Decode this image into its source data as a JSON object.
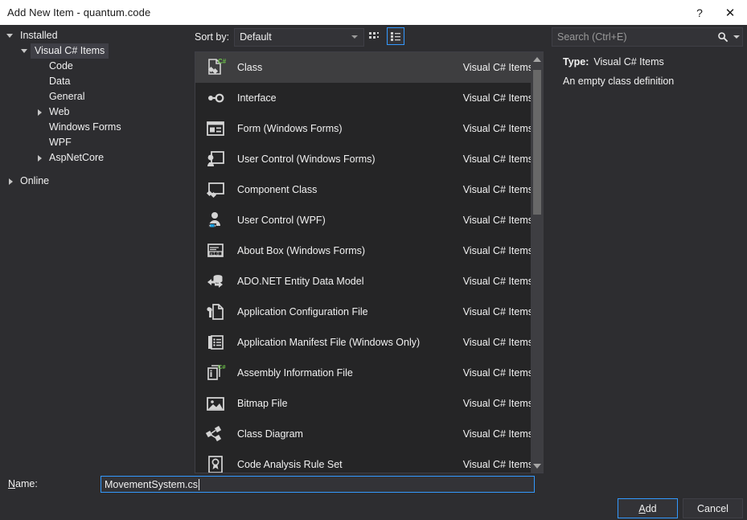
{
  "window": {
    "title": "Add New Item - quantum.code",
    "help_label": "?",
    "close_label": "✕"
  },
  "sidebar": {
    "groups": [
      {
        "label": "Installed",
        "expander": "down",
        "level": 0,
        "selected": false
      },
      {
        "label": "Visual C# Items",
        "expander": "down",
        "level": 1,
        "selected": true
      },
      {
        "label": "Code",
        "expander": "none",
        "level": 2,
        "selected": false
      },
      {
        "label": "Data",
        "expander": "none",
        "level": 2,
        "selected": false
      },
      {
        "label": "General",
        "expander": "none",
        "level": 2,
        "selected": false
      },
      {
        "label": "Web",
        "expander": "right",
        "level": 2,
        "selected": false
      },
      {
        "label": "Windows Forms",
        "expander": "none",
        "level": 2,
        "selected": false
      },
      {
        "label": "WPF",
        "expander": "none",
        "level": 2,
        "selected": false
      },
      {
        "label": "AspNetCore",
        "expander": "right",
        "level": 2,
        "selected": false
      },
      {
        "label": "Online",
        "expander": "right",
        "level": 0,
        "selected": false
      }
    ]
  },
  "toolbar": {
    "sort_label": "Sort by:",
    "sort_value": "Default",
    "grid_view_name": "grid-view-icon",
    "list_view_name": "list-view-icon",
    "active_view": "list"
  },
  "search": {
    "placeholder": "Search (Ctrl+E)",
    "value": "",
    "icon": "search-icon",
    "dropdown_icon": "chevron-down-icon"
  },
  "list": {
    "items": [
      {
        "name": "Class",
        "category": "Visual C# Items",
        "icon": "class-file-icon",
        "selected": true
      },
      {
        "name": "Interface",
        "category": "Visual C# Items",
        "icon": "interface-icon",
        "selected": false
      },
      {
        "name": "Form (Windows Forms)",
        "category": "Visual C# Items",
        "icon": "form-icon",
        "selected": false
      },
      {
        "name": "User Control (Windows Forms)",
        "category": "Visual C# Items",
        "icon": "user-control-winforms-icon",
        "selected": false
      },
      {
        "name": "Component Class",
        "category": "Visual C# Items",
        "icon": "component-class-icon",
        "selected": false
      },
      {
        "name": "User Control (WPF)",
        "category": "Visual C# Items",
        "icon": "user-control-wpf-icon",
        "selected": false
      },
      {
        "name": "About Box (Windows Forms)",
        "category": "Visual C# Items",
        "icon": "about-box-icon",
        "selected": false
      },
      {
        "name": "ADO.NET Entity Data Model",
        "category": "Visual C# Items",
        "icon": "ado-net-entity-icon",
        "selected": false
      },
      {
        "name": "Application Configuration File",
        "category": "Visual C# Items",
        "icon": "app-config-icon",
        "selected": false
      },
      {
        "name": "Application Manifest File (Windows Only)",
        "category": "Visual C# Items",
        "icon": "app-manifest-icon",
        "selected": false
      },
      {
        "name": "Assembly Information File",
        "category": "Visual C# Items",
        "icon": "assembly-info-icon",
        "selected": false
      },
      {
        "name": "Bitmap File",
        "category": "Visual C# Items",
        "icon": "bitmap-icon",
        "selected": false
      },
      {
        "name": "Class Diagram",
        "category": "Visual C# Items",
        "icon": "class-diagram-icon",
        "selected": false
      },
      {
        "name": "Code Analysis Rule Set",
        "category": "Visual C# Items",
        "icon": "rule-set-icon",
        "selected": false
      }
    ]
  },
  "details": {
    "type_key": "Type:",
    "type_value": "Visual C# Items",
    "description": "An empty class definition"
  },
  "name_field": {
    "label_prefix": "",
    "label_accel": "N",
    "label_suffix": "ame:",
    "value": "MovementSystem.cs"
  },
  "buttons": {
    "add_accel": "A",
    "add_rest": "dd",
    "cancel": "Cancel"
  },
  "colors": {
    "accent": "#3399ff",
    "dialog_bg": "#2d2d30",
    "list_bg": "#252526",
    "selected_row": "#3e3e40",
    "csharp_green": "#6cc24a"
  }
}
